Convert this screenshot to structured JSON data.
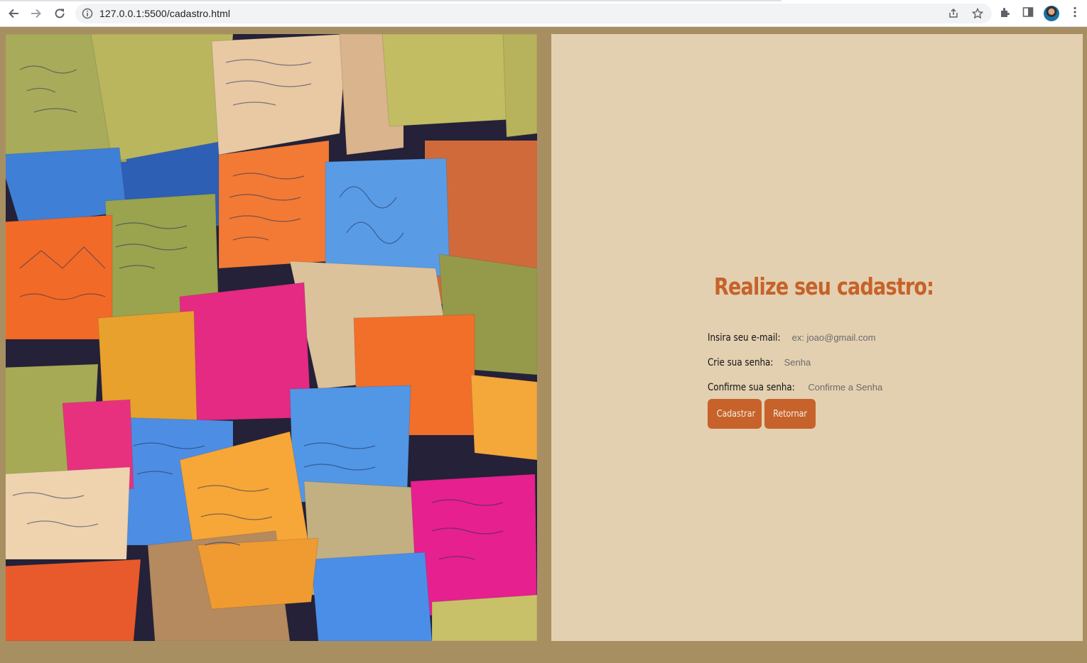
{
  "browser": {
    "url": "127.0.0.1:5500/cadastro.html"
  },
  "form": {
    "title": "Realize seu cadastro:",
    "email": {
      "label": "Insira seu e-mail:",
      "placeholder": "ex: joao@gmail.com"
    },
    "password": {
      "label": "Crie sua senha:",
      "placeholder": "Senha"
    },
    "confirm": {
      "label": "Confirme sua senha:",
      "placeholder": "Confirme a Senha"
    },
    "submit_label": "Cadastrar",
    "back_label": "Retornar"
  },
  "colors": {
    "page_background": "#a88f62",
    "panel_background": "#e3d0b1",
    "accent": "#c6622a"
  }
}
